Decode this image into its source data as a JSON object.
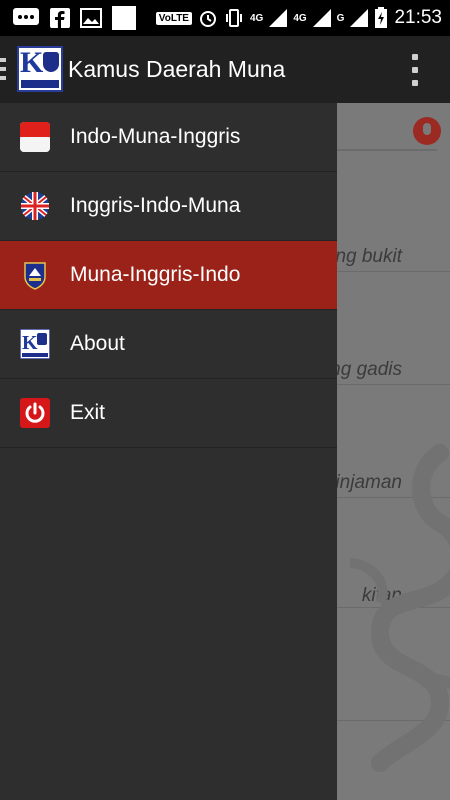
{
  "statusbar": {
    "volte": "VoLTE",
    "net1": "4G",
    "net2": "4G",
    "net3": "G",
    "time": "21:53"
  },
  "appbar": {
    "title": "Kamus Daerah Muna",
    "logo_text": "Kamus Daerah Muna"
  },
  "drawer": {
    "items": [
      {
        "label": "Indo-Muna-Inggris",
        "icon": "indonesia-flag-icon",
        "active": false
      },
      {
        "label": "Inggris-Indo-Muna",
        "icon": "uk-flag-icon",
        "active": false
      },
      {
        "label": "Muna-Inggris-Indo",
        "icon": "muna-emblem-icon",
        "active": true
      },
      {
        "label": "About",
        "icon": "app-logo-icon",
        "active": false
      },
      {
        "label": "Exit",
        "icon": "power-icon",
        "active": false
      }
    ]
  },
  "background_rows": [
    "ng bukit",
    "ng gadis",
    "pinjaman",
    "kitan"
  ],
  "colors": {
    "accent": "#9b2219",
    "drawer_bg": "#2e2e2e",
    "appbar_bg": "#212121"
  }
}
